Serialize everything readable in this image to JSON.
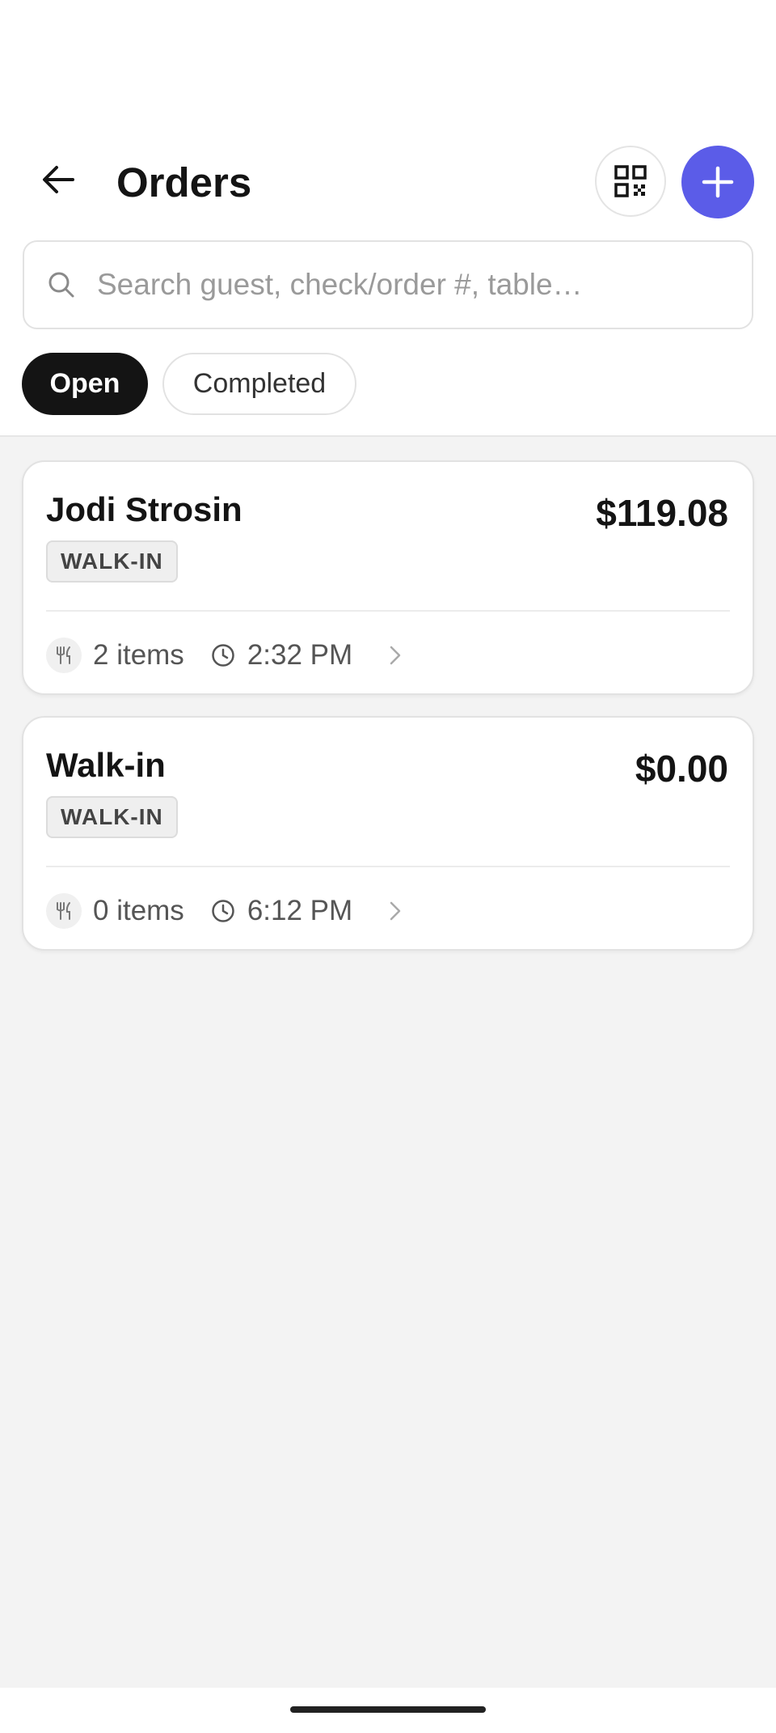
{
  "header": {
    "title": "Orders",
    "back_icon": "arrow-left-icon",
    "qr_icon": "qr-code-icon",
    "add_icon": "plus-icon"
  },
  "search": {
    "placeholder": "Search guest, check/order #, table…",
    "icon": "search-icon"
  },
  "filters": [
    {
      "label": "Open",
      "selected": true
    },
    {
      "label": "Completed",
      "selected": false
    }
  ],
  "orders": [
    {
      "guest": "Jodi Strosin",
      "amount": "$119.08",
      "badge": "WALK-IN",
      "items": "2 items",
      "time": "2:32 PM"
    },
    {
      "guest": "Walk-in",
      "amount": "$0.00",
      "badge": "WALK-IN",
      "items": "0 items",
      "time": "6:12 PM"
    }
  ],
  "colors": {
    "accent": "#5b5ce8",
    "selected_chip": "#141414",
    "background": "#f3f3f3"
  }
}
